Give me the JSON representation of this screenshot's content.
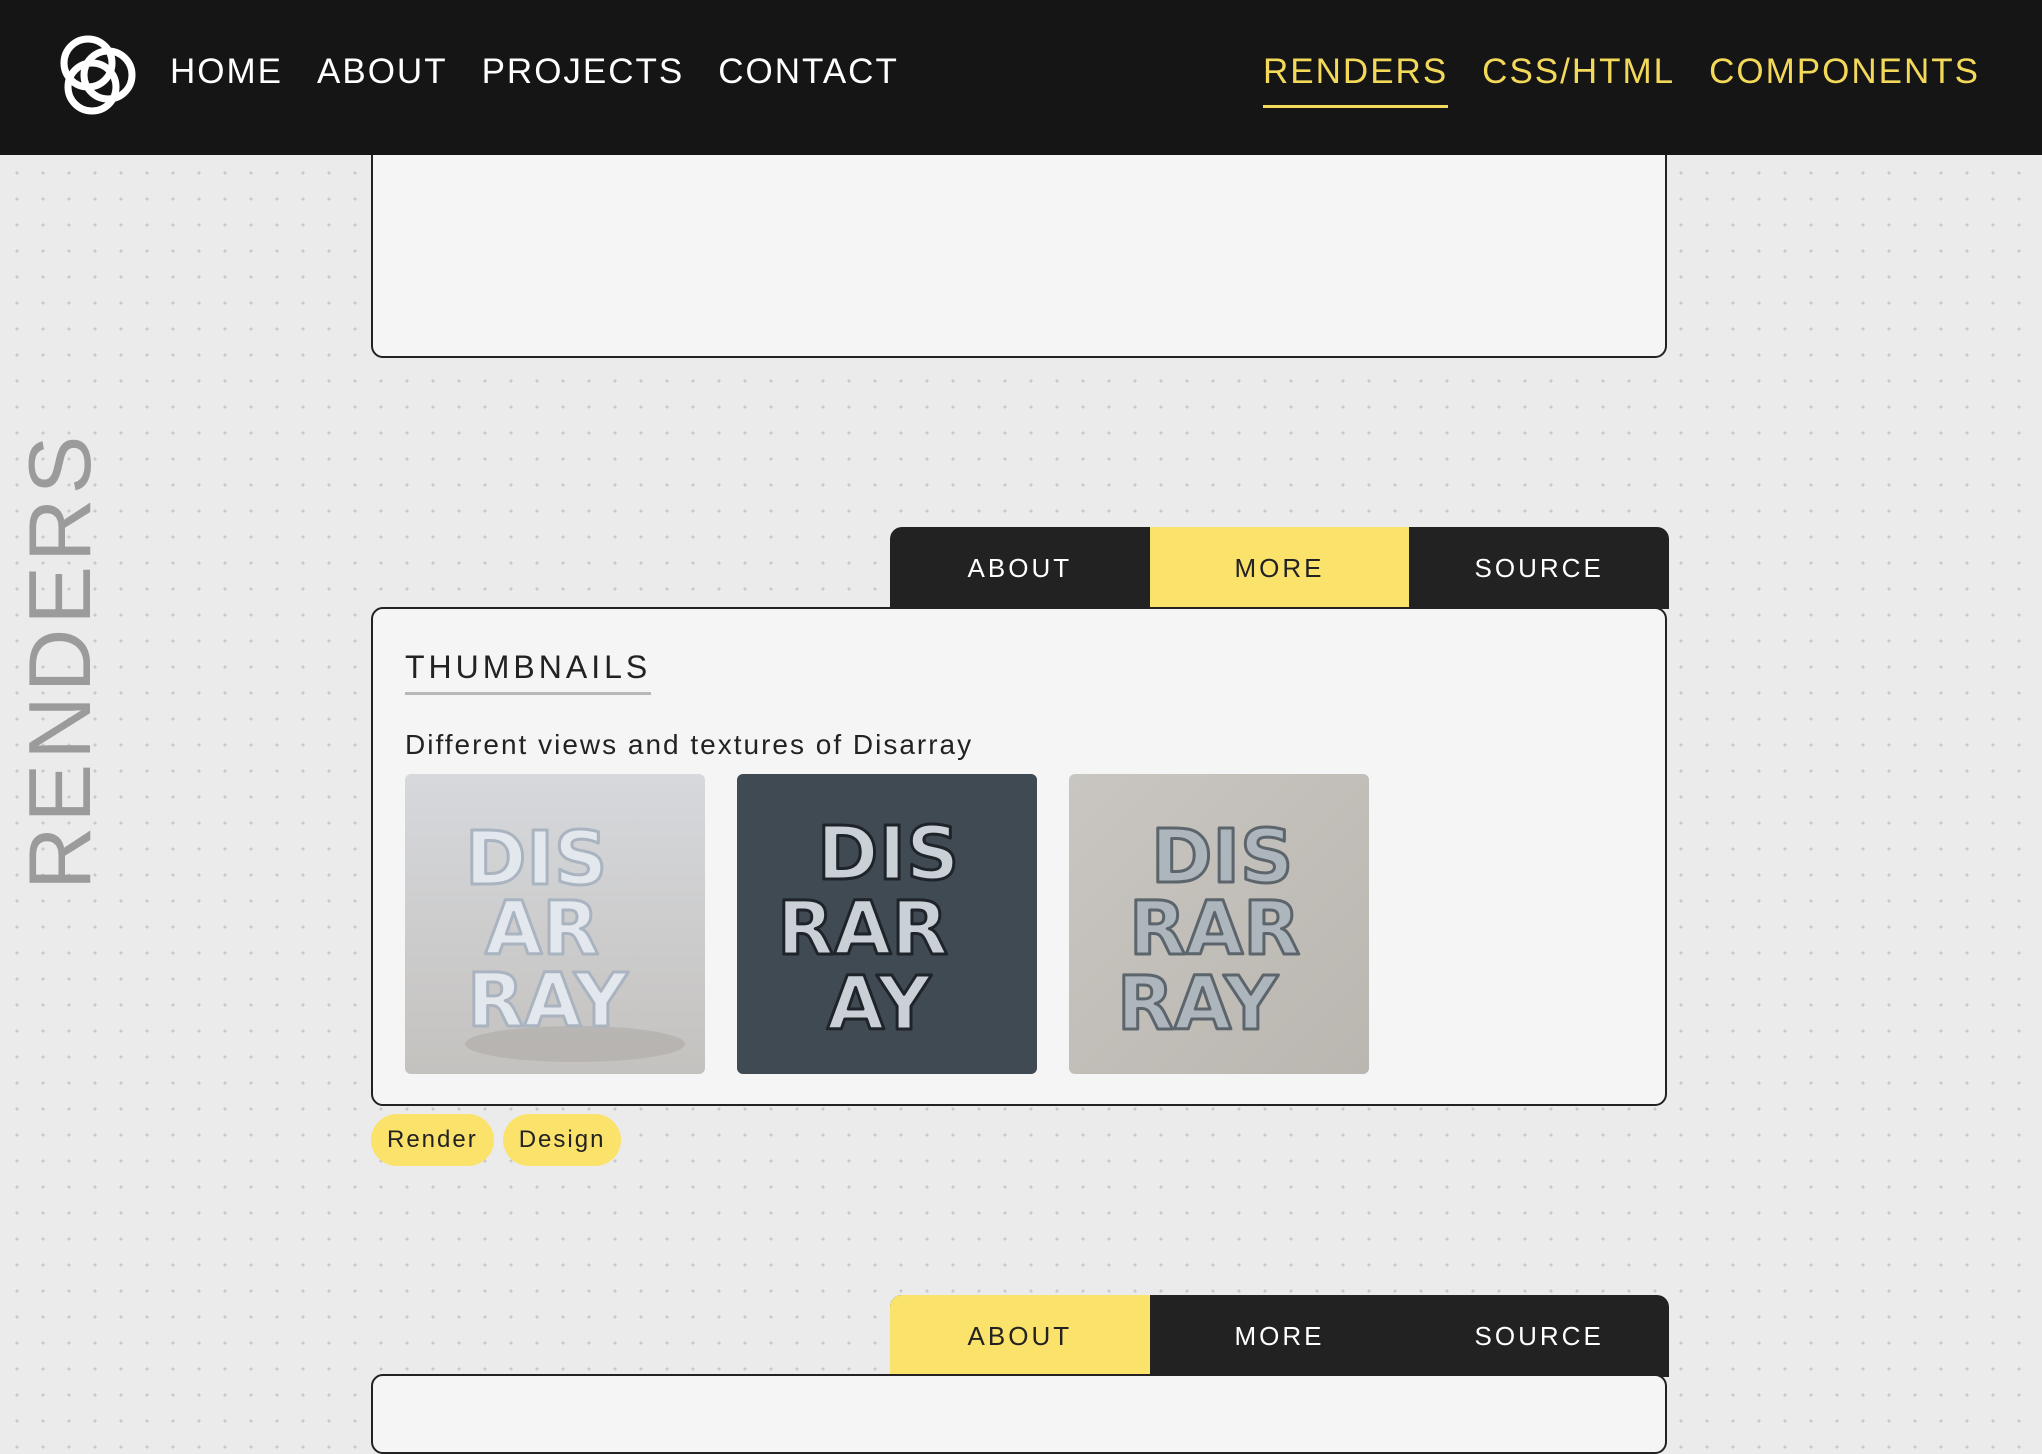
{
  "nav": {
    "logo_icon": "interlocking-rings-logo",
    "left_links": [
      "HOME",
      "ABOUT",
      "PROJECTS",
      "CONTACT"
    ],
    "right_links": [
      "RENDERS",
      "CSS/HTML",
      "COMPONENTS"
    ],
    "active_right": "RENDERS"
  },
  "side_label": "RENDERS",
  "cards": [
    {
      "tabs": [
        "ABOUT",
        "MORE",
        "SOURCE"
      ],
      "active_tab": "MORE",
      "heading": "THUMBNAILS",
      "description": "Different views and textures of Disarray",
      "thumbnails": [
        {
          "text": "DIS AR RAY",
          "variant": "light"
        },
        {
          "text": "DIS AR RAY",
          "variant": "dark"
        },
        {
          "text": "DIS AR RAY",
          "variant": "chrome"
        }
      ],
      "tags": [
        "Render",
        "Design"
      ]
    },
    {
      "tabs": [
        "ABOUT",
        "MORE",
        "SOURCE"
      ],
      "active_tab": "ABOUT"
    }
  ],
  "colors": {
    "accent": "#fbe26a",
    "nav_bg": "#151515",
    "nav_link_accent": "#f3d95a"
  }
}
